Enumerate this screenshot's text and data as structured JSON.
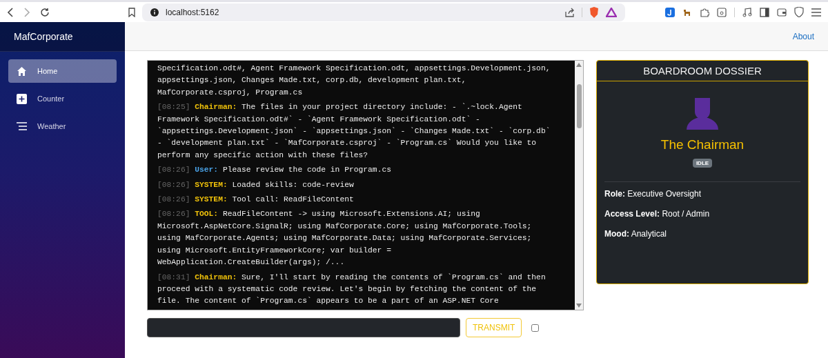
{
  "browser": {
    "url": "localhost:5162"
  },
  "sidebar": {
    "brand": "MafCorporate",
    "items": [
      {
        "label": "Home",
        "kind": "home",
        "selected": true
      },
      {
        "label": "Counter",
        "kind": "counter",
        "selected": false
      },
      {
        "label": "Weather",
        "kind": "weather",
        "selected": false
      }
    ]
  },
  "topbar": {
    "link": "About"
  },
  "log": [
    {
      "kind": "continuation",
      "text": "Specification.odt#, Agent Framework Specification.odt, appsettings.Development.json, appsettings.json, Changes Made.txt, corp.db, development plan.txt, MafCorporate.csproj, Program.cs"
    },
    {
      "kind": "agent",
      "time": "[08:25]",
      "speaker": "Chairman:",
      "text": "The files in your project directory include: - `.~lock.Agent Framework Specification.odt#` - `Agent Framework Specification.odt` - `appsettings.Development.json` - `appsettings.json` - `Changes Made.txt` - `corp.db` - `development plan.txt` - `MafCorporate.csproj` - `Program.cs` Would you like to perform any specific action with these files?"
    },
    {
      "kind": "user",
      "time": "[08:26]",
      "speaker": "User:",
      "text": "Please review the code in Program.cs"
    },
    {
      "kind": "system",
      "time": "[08:26]",
      "speaker": "SYSTEM:",
      "text": "Loaded skills: code-review"
    },
    {
      "kind": "system",
      "time": "[08:26]",
      "speaker": "SYSTEM:",
      "text": "Tool call: ReadFileContent"
    },
    {
      "kind": "system",
      "time": "[08:26]",
      "speaker": "TOOL:",
      "text": "ReadFileContent -> using Microsoft.Extensions.AI; using Microsoft.AspNetCore.SignalR; using MafCorporate.Core; using MafCorporate.Tools; using MafCorporate.Agents; using MafCorporate.Data; using MafCorporate.Services; using Microsoft.EntityFrameworkCore; var builder = WebApplication.CreateBuilder(args); /..."
    },
    {
      "kind": "agent",
      "time": "[08:31]",
      "speaker": "Chairman:",
      "text": "Sure, I'll start by reading the contents of `Program.cs` and then proceed with a systematic code review. Let's begin by fetching the content of the file. The content of `Program.cs` appears to be a part of an ASP.NET Core"
    }
  ],
  "composer": {
    "button": "TRANSMIT",
    "checked": false
  },
  "dossier": {
    "title": "BOARDROOM DOSSIER",
    "name": "The Chairman",
    "status": "IDLE",
    "facts": [
      {
        "label": "Role:",
        "value": "Executive Oversight"
      },
      {
        "label": "Access Level:",
        "value": "Root / Admin"
      },
      {
        "label": "Mood:",
        "value": "Analytical"
      }
    ]
  }
}
